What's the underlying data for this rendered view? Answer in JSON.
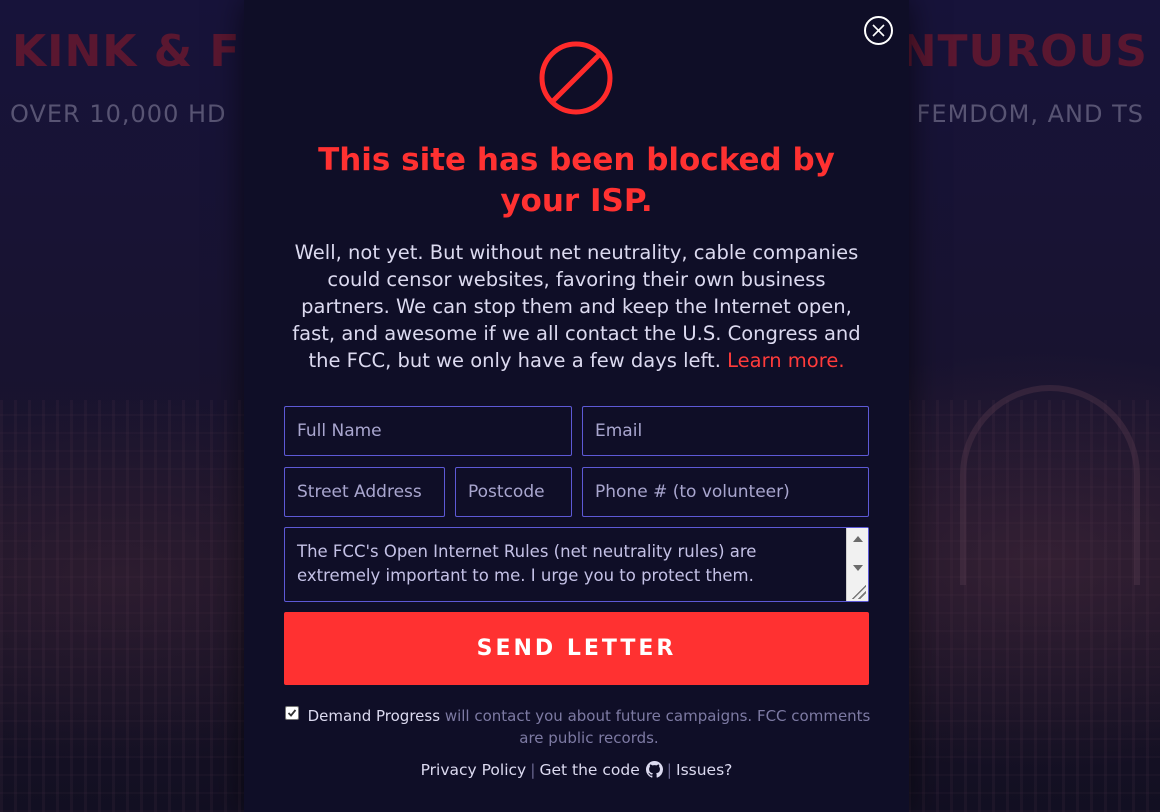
{
  "background": {
    "headline_left": "KINK & FE",
    "headline_right": "NTUROUS",
    "sub_left": "OVER 10,000 HD",
    "sub_right": "FEMDOM, AND TS"
  },
  "modal": {
    "title": "This site has been blocked by your ISP.",
    "intro": "Well, not yet. But without net neutrality, cable companies could censor websites, favoring their own business partners. We can stop them and keep the Internet open, fast, and awesome if we all contact the U.S. Congress and the FCC, but we only have a few days left.",
    "learn_more": "Learn more.",
    "form": {
      "full_name_placeholder": "Full Name",
      "email_placeholder": "Email",
      "street_placeholder": "Street Address",
      "postcode_placeholder": "Postcode",
      "phone_placeholder": "Phone # (to volunteer)",
      "letter_text": "The FCC's Open Internet Rules (net neutrality rules) are extremely important to me. I urge you to protect them.",
      "send_label": "SEND LETTER"
    },
    "consent": {
      "checked": true,
      "org": "Demand Progress",
      "text": "will contact you about future campaigns. FCC comments are public records."
    },
    "footer": {
      "privacy": "Privacy Policy",
      "separator": "|",
      "get_code": "Get the code",
      "issues": "Issues?"
    }
  },
  "colors": {
    "accent_red": "#ff3131",
    "modal_bg": "#0f0e27",
    "field_border": "#5d59d6"
  },
  "icons": {
    "close": "close-icon",
    "blocked": "prohibited-icon",
    "github": "github-icon",
    "check": "checkmark-icon"
  }
}
